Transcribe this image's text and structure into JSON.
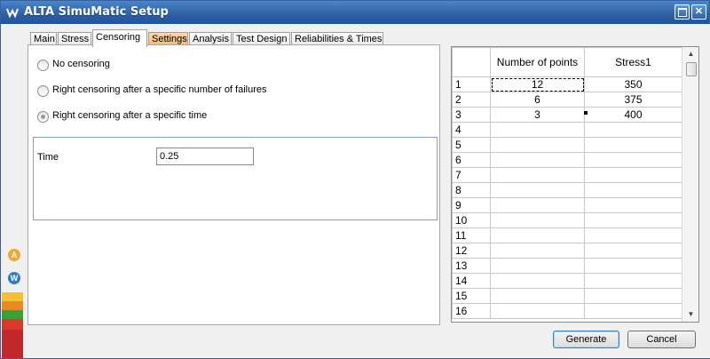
{
  "window": {
    "title": "ALTA SimuMatic Setup"
  },
  "tabs": [
    {
      "label": "Main"
    },
    {
      "label": "Stress"
    },
    {
      "label": "Censoring"
    },
    {
      "label": "Settings"
    },
    {
      "label": "Analysis"
    },
    {
      "label": "Test Design"
    },
    {
      "label": "Reliabilities & Times"
    }
  ],
  "active_tab": "Censoring",
  "highlight_tab": "Settings",
  "censoring": {
    "options": [
      {
        "label": "No censoring",
        "selected": false
      },
      {
        "label": "Right censoring after a specific number of failures",
        "selected": false
      },
      {
        "label": "Right censoring after a specific time",
        "selected": true
      }
    ],
    "time_label": "Time",
    "time_value": "0.25"
  },
  "grid": {
    "headers": [
      "Number of points",
      "Stress1"
    ],
    "rows": [
      {
        "n": "1",
        "points": "12",
        "stress": "350"
      },
      {
        "n": "2",
        "points": "6",
        "stress": "375"
      },
      {
        "n": "3",
        "points": "3",
        "stress": "400"
      },
      {
        "n": "4",
        "points": "",
        "stress": ""
      },
      {
        "n": "5",
        "points": "",
        "stress": ""
      },
      {
        "n": "6",
        "points": "",
        "stress": ""
      },
      {
        "n": "7",
        "points": "",
        "stress": ""
      },
      {
        "n": "8",
        "points": "",
        "stress": ""
      },
      {
        "n": "9",
        "points": "",
        "stress": ""
      },
      {
        "n": "10",
        "points": "",
        "stress": ""
      },
      {
        "n": "11",
        "points": "",
        "stress": ""
      },
      {
        "n": "12",
        "points": "",
        "stress": ""
      },
      {
        "n": "13",
        "points": "",
        "stress": ""
      },
      {
        "n": "14",
        "points": "",
        "stress": ""
      },
      {
        "n": "15",
        "points": "",
        "stress": ""
      },
      {
        "n": "16",
        "points": "",
        "stress": ""
      }
    ]
  },
  "buttons": {
    "generate": "Generate",
    "cancel": "Cancel"
  },
  "colors": {
    "titlebar": "#2d5fa3",
    "tab_highlight": "#f8b86a"
  }
}
